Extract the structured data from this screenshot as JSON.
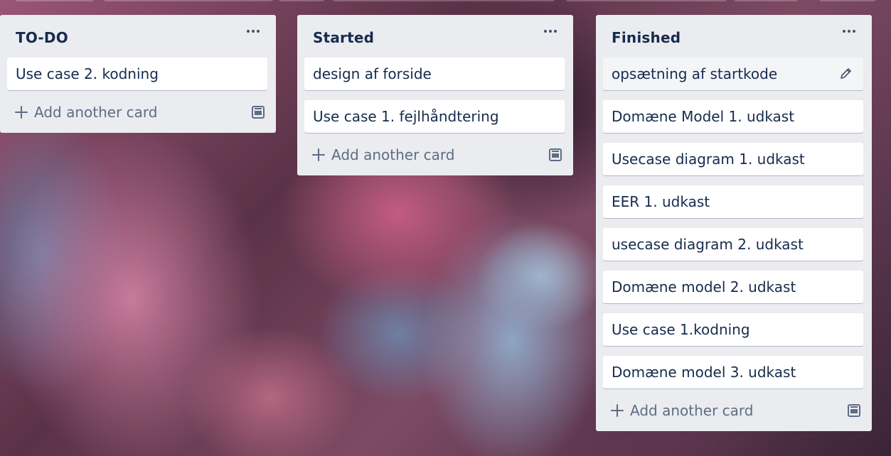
{
  "lists": [
    {
      "title": "TO-DO",
      "cards": [
        "Use case 2. kodning"
      ],
      "add_label": "Add another card"
    },
    {
      "title": "Started",
      "cards": [
        "design af forside",
        "Use case 1. fejlhåndtering"
      ],
      "add_label": "Add another card"
    },
    {
      "title": "Finished",
      "cards": [
        "opsætning af startkode",
        "Domæne Model 1. udkast",
        "Usecase diagram 1. udkast",
        "EER 1. udkast",
        "usecase diagram 2. udkast",
        "Domæne model 2. udkast",
        "Use case 1.kodning",
        "Domæne model 3. udkast"
      ],
      "add_label": "Add another card"
    }
  ],
  "icons": {
    "list_menu": "more-horizontal-icon",
    "add": "plus-icon",
    "card_edit": "pencil-icon",
    "template": "card-template-icon"
  },
  "colors": {
    "list_background": "#ebecf0",
    "card_background": "#ffffff",
    "title_text": "#172b4d",
    "muted_text": "#5e6c84"
  }
}
